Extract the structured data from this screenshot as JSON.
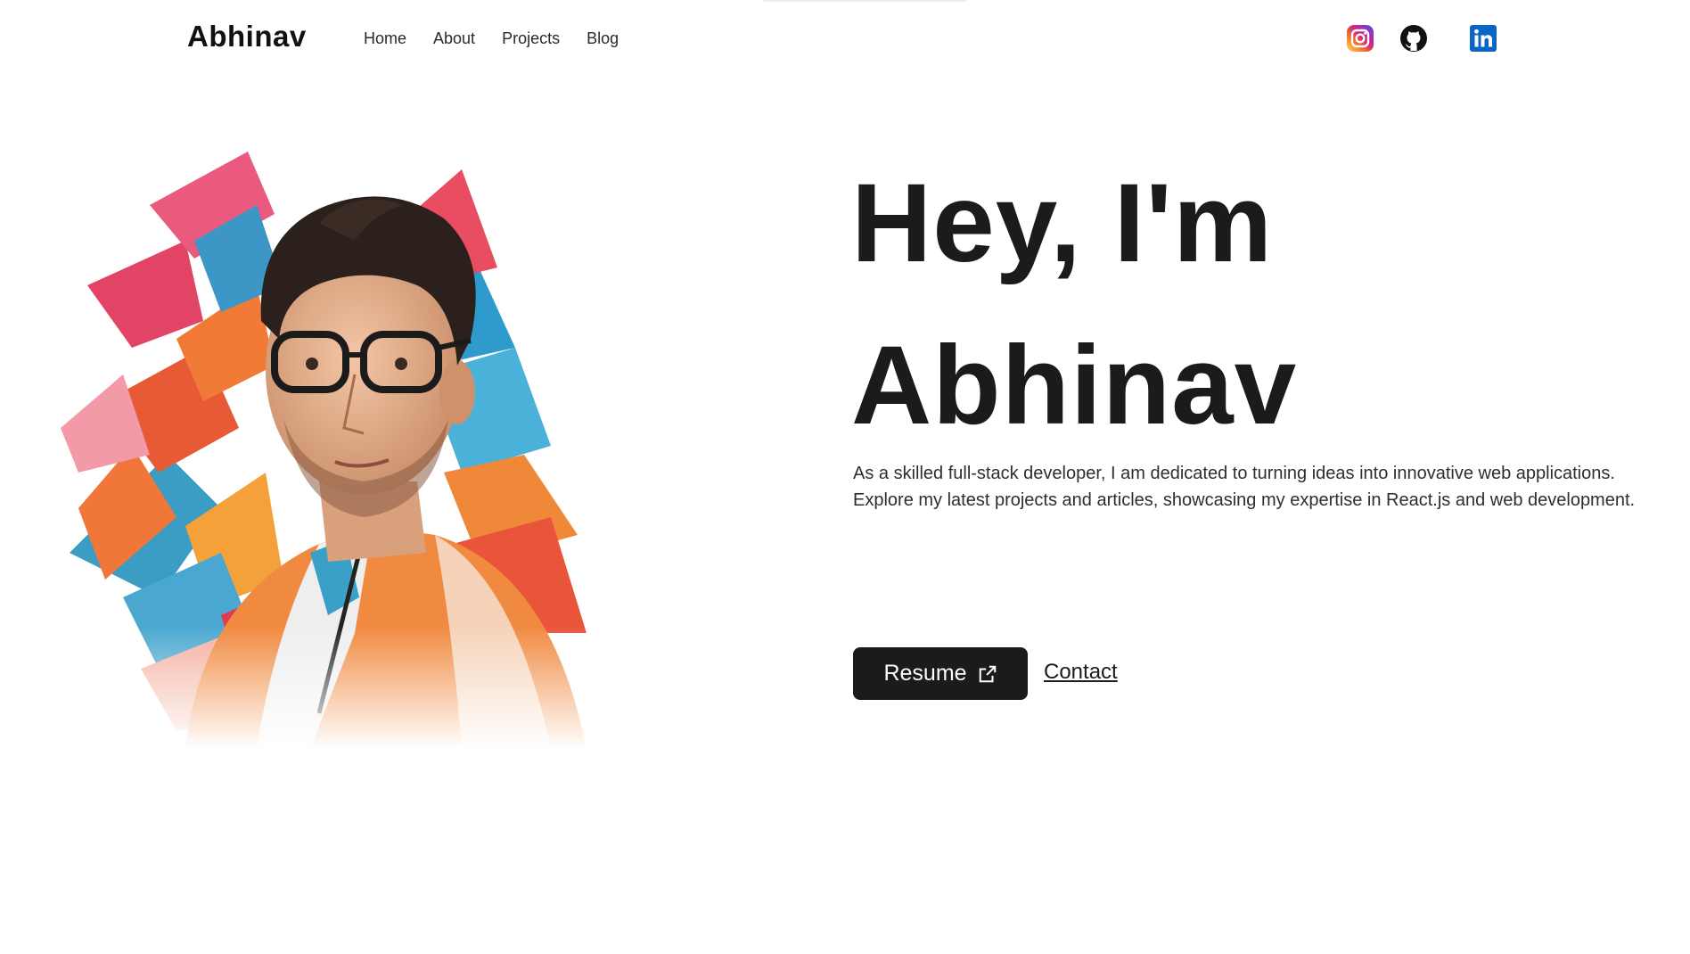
{
  "header": {
    "logo": "Abhinav",
    "nav": [
      {
        "label": "Home"
      },
      {
        "label": "About"
      },
      {
        "label": "Projects"
      },
      {
        "label": "Blog"
      }
    ],
    "socials": [
      {
        "icon": "instagram-icon"
      },
      {
        "icon": "github-icon"
      },
      {
        "icon": "linkedin-icon"
      }
    ]
  },
  "hero": {
    "title_line1": "Hey, I'm",
    "title_line2": "Abhinav",
    "description": "As a skilled full-stack developer, I am dedicated to turning ideas into innovative web applications. Explore my latest projects and articles, showcasing my expertise in React.js and web development.",
    "resume_label": "Resume",
    "contact_label": "Contact"
  },
  "colors": {
    "text": "#1b1b1b",
    "button_bg": "#1b1b1b",
    "linkedin": "#0a66c2"
  }
}
